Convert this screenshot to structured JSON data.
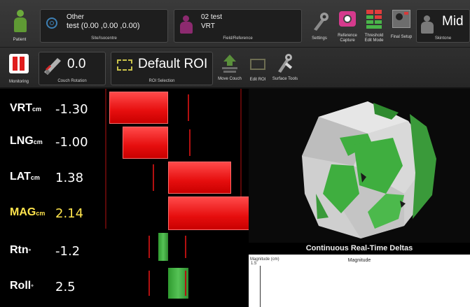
{
  "toolbar": {
    "patient_label": "Patient",
    "site": {
      "name": "Other",
      "coords": "test (0.00 ,0.00 ,0.00)",
      "caption": "Site/Isocentre"
    },
    "field": {
      "name": "02 test",
      "ref": "VRT",
      "caption": "Field/Reference"
    },
    "settings_label": "Settings",
    "reference_capture_label": "Reference Capture",
    "threshold_label": "Threshold Edit Mode",
    "final_setup_label": "Final Setup",
    "skintone": {
      "value": "Mid",
      "caption": "Skintone"
    },
    "monitoring_label": "Monitoring",
    "couch_rotation": {
      "value": "0.0",
      "caption": "Couch Rotation"
    },
    "roi": {
      "value": "Default ROI",
      "caption": "ROI Selection"
    },
    "move_couch_label": "Move Couch",
    "edit_roi_label": "Edit ROI",
    "surface_tools_label": "Surface Tools"
  },
  "deltas": [
    {
      "name": "VRT",
      "unit": "cm",
      "value": "-1.30",
      "color": "red",
      "bar_value": -1.3
    },
    {
      "name": "LNG",
      "unit": "cm",
      "value": "-1.00",
      "color": "red",
      "bar_value": -1.0
    },
    {
      "name": "LAT",
      "unit": "cm",
      "value": "1.38",
      "color": "red",
      "bar_value": 1.38
    },
    {
      "name": "MAG",
      "unit": "cm",
      "value": "2.14",
      "color": "red",
      "bar_value": 2.14
    },
    {
      "name": "Rtn",
      "unit": "°",
      "value": "-1.2",
      "color": "green",
      "bar_value": -1.2
    },
    {
      "name": "Roll",
      "unit": "°",
      "value": "2.5",
      "color": "green",
      "bar_value": 2.5
    }
  ],
  "continuous": {
    "title": "Continuous Real-Time Deltas",
    "plot_title": "Magnitude",
    "ylabel": "Magnitude (cm)",
    "ytick_top": "1.5"
  },
  "colors": {
    "accent_red": "#e60e0e",
    "accent_green": "#3fae3f",
    "threshold_line": "#b31010"
  }
}
